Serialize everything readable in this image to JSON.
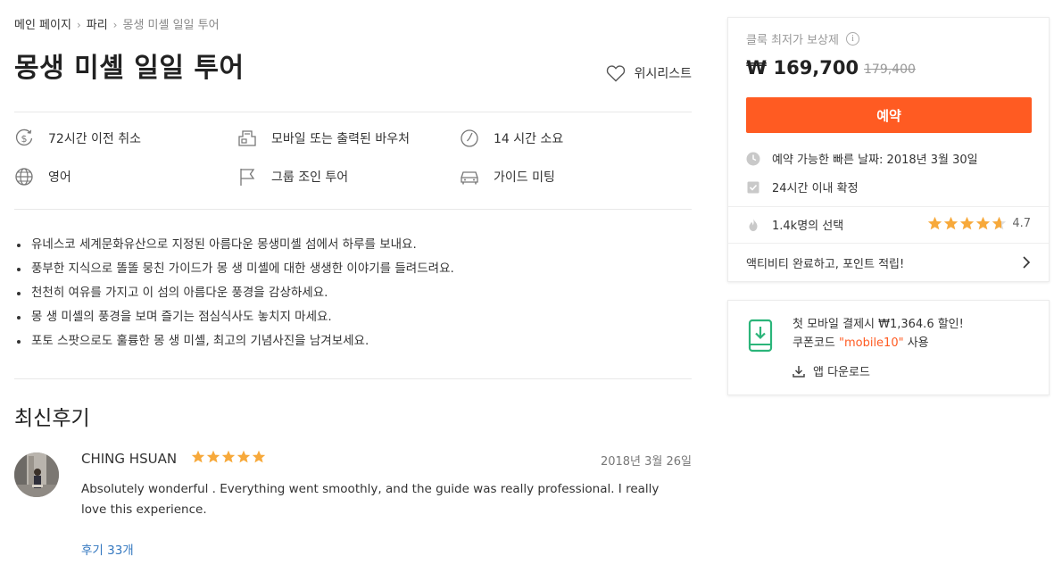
{
  "breadcrumb": {
    "items": [
      "메인 페이지",
      "파리",
      "몽생 미셸 일일 투어"
    ],
    "separator": "›"
  },
  "title": "몽생 미셸 일일 투어",
  "wishlist": {
    "label": "위시리스트",
    "icon": "heart-icon"
  },
  "features": [
    {
      "icon": "dollar-cancel-icon",
      "label": "72시간 이전 취소"
    },
    {
      "icon": "voucher-icon",
      "label": "모바일 또는 출력된 바우처"
    },
    {
      "icon": "clock-icon",
      "label": "14 시간 소요"
    },
    {
      "icon": "globe-icon",
      "label": "영어"
    },
    {
      "icon": "flag-icon",
      "label": "그룹 조인 투어"
    },
    {
      "icon": "car-icon",
      "label": "가이드 미팅"
    }
  ],
  "highlights": [
    "유네스코 세계문화유산으로 지정된 아름다운 몽생미셸 섬에서 하루를 보내요.",
    "풍부한 지식으로 똘똘 뭉친 가이드가 몽 생 미셸에 대한 생생한 이야기를 들려드려요.",
    "천천히 여유를 가지고 이 섬의 아름다운 풍경을 감상하세요.",
    "몽 생 미셸의 풍경을 보며 즐기는 점심식사도 놓치지 마세요.",
    "포토 스팟으로도 훌륭한 몽 생 미셸, 최고의 기념사진을 남겨보세요."
  ],
  "reviews": {
    "title": "최신후기",
    "item": {
      "name": "CHING HSUAN",
      "stars": 5,
      "date": "2018년 3월 26일",
      "text": "Absolutely wonderful . Everything went smoothly, and the guide was really professional. I really love this experience."
    },
    "more_link": "후기 33개"
  },
  "booking": {
    "price_label": "클룩 최저가 보상제",
    "price": "₩ 169,700",
    "old_price": "179,400",
    "book_button": "예약",
    "earliest_date": "예약 가능한 빠른 날짜: 2018년 3월 30일",
    "confirm": "24시간 이내 확정",
    "chosen": "1.4k명의 선택",
    "rating": "4.7",
    "rating_value": 4.7,
    "points": "액티비티 완료하고, 포인트 적립!"
  },
  "mobile": {
    "line1": "첫 모바일 결제시 ₩1,364.6 할인!",
    "coupon_prefix": "쿠폰코드 ",
    "coupon_code": "\"mobile10\"",
    "coupon_suffix": " 사용",
    "download": "앱 다운로드"
  },
  "colors": {
    "accent": "#ff5b22",
    "star": "#f7a93b",
    "link": "#3478c0",
    "mobile_icon": "#2bb57a"
  }
}
